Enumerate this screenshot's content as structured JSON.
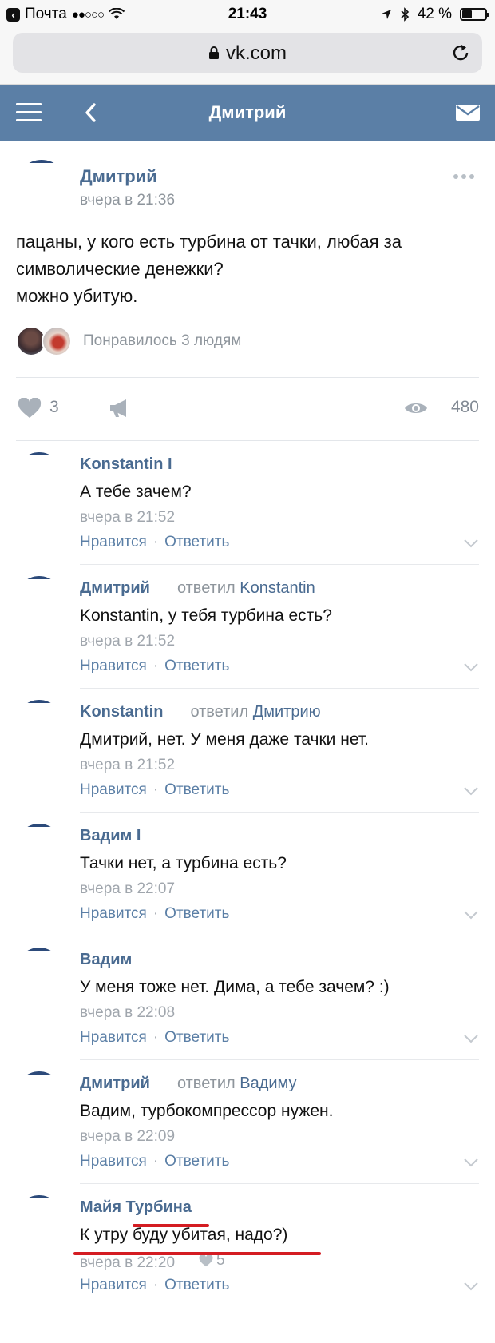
{
  "statusbar": {
    "carrier": "Почта",
    "signal": "●●○○○",
    "time": "21:43",
    "battery": "42 %",
    "battery_level": 0.42
  },
  "browser": {
    "url": "vk.com"
  },
  "header": {
    "title": "Дмитрий"
  },
  "post": {
    "author": "Дмитрий",
    "date": "вчера в 21:36",
    "text_lines": [
      "пацаны, у кого есть турбина от тачки, любая за",
      "символические денежки?",
      "можно убитую."
    ],
    "liked_by": "Понравилось 3 людям",
    "likes": "3",
    "views": "480"
  },
  "comment_actions": {
    "like": "Нравится",
    "sep": "·",
    "reply": "Ответить"
  },
  "comments": [
    {
      "name": "Konstantin I",
      "replied": "",
      "replied_to": "",
      "text": "А тебе зачем?",
      "date": "вчера в 21:52"
    },
    {
      "name": "Дмитрий",
      "replied": "ответил",
      "replied_to": "Konstantin",
      "text": "Konstantin, у тебя турбина есть?",
      "date": "вчера в 21:52"
    },
    {
      "name": "Konstantin",
      "replied": "ответил",
      "replied_to": "Дмитрию",
      "text": "Дмитрий, нет. У меня даже тачки нет.",
      "date": "вчера в 21:52"
    },
    {
      "name": "Вадим I",
      "replied": "",
      "replied_to": "",
      "text": "Тачки нет, а турбина есть?",
      "date": "вчера в 22:07"
    },
    {
      "name": "Вадим",
      "replied": "",
      "replied_to": "",
      "text": "У меня тоже нет. Дима, а тебе зачем? :)",
      "date": "вчера в 22:08"
    },
    {
      "name": "Дмитрий",
      "replied": "ответил",
      "replied_to": "Вадиму",
      "text": "Вадим, турбокомпрессор нужен.",
      "date": "вчера в 22:09"
    },
    {
      "name": "Майя Турбина",
      "replied": "",
      "replied_to": "",
      "text": "К утру буду убитая, надо?)",
      "date": "вчера в 22:20",
      "likes": "5"
    }
  ],
  "colors": {
    "vk_header": "#5b7fa6",
    "link": "#4a6b91",
    "highlight": "#d41c22"
  }
}
